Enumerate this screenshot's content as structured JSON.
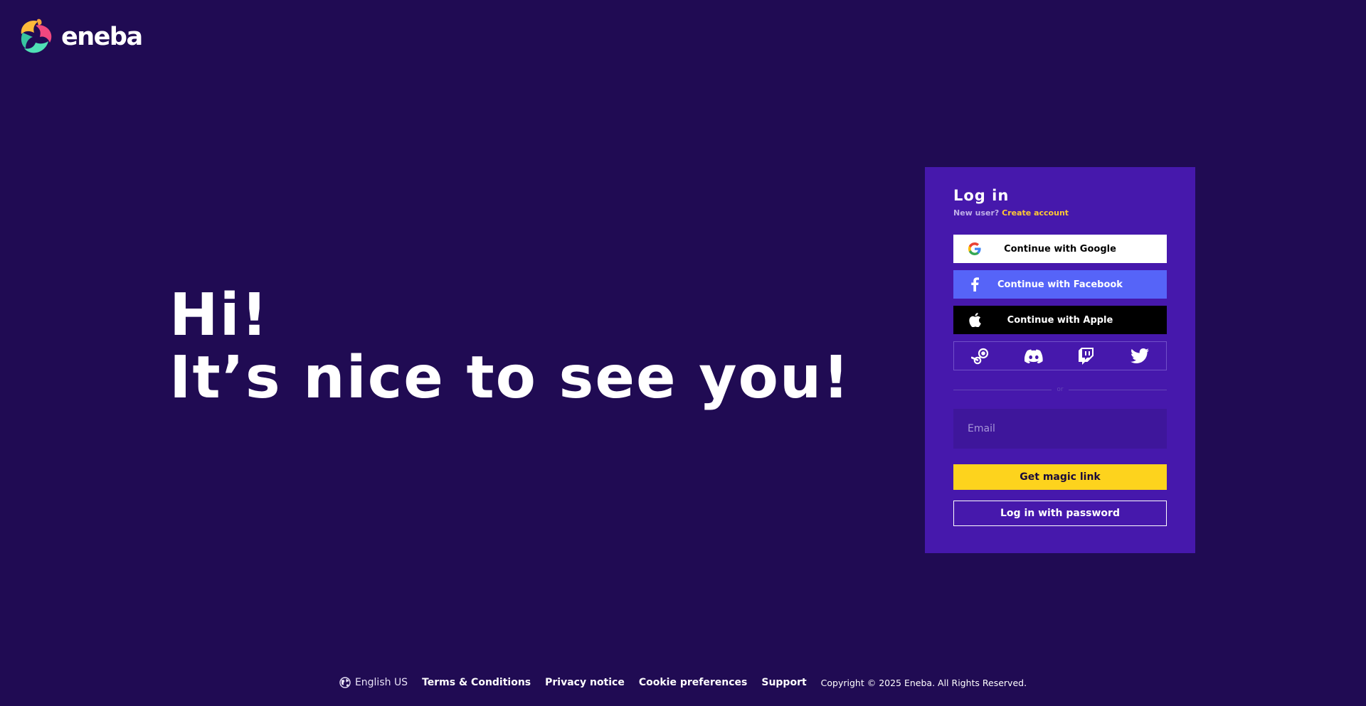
{
  "brand": {
    "name": "eneba"
  },
  "hero": {
    "line1": "Hi!",
    "line2": "It’s nice to see you!"
  },
  "login": {
    "title": "Log in",
    "new_user_label": "New user?",
    "create_account_label": "Create account",
    "google_label": "Continue with Google",
    "facebook_label": "Continue with Facebook",
    "apple_label": "Continue with Apple",
    "divider_text": "or",
    "email_placeholder": "Email",
    "magic_link_label": "Get magic link",
    "password_login_label": "Log in with password",
    "platforms": [
      "steam-icon",
      "discord-icon",
      "twitch-icon",
      "twitter-icon"
    ]
  },
  "footer": {
    "language": "English US",
    "terms": "Terms & Conditions",
    "privacy": "Privacy notice",
    "cookies": "Cookie preferences",
    "support": "Support",
    "copyright": "Copyright © 2025 Eneba. All Rights Reserved."
  },
  "colors": {
    "background": "#200b53",
    "card": "#4618ac",
    "accent_yellow": "#fdd31d",
    "link_yellow": "#ffc933",
    "facebook_blue": "#5664f8"
  }
}
